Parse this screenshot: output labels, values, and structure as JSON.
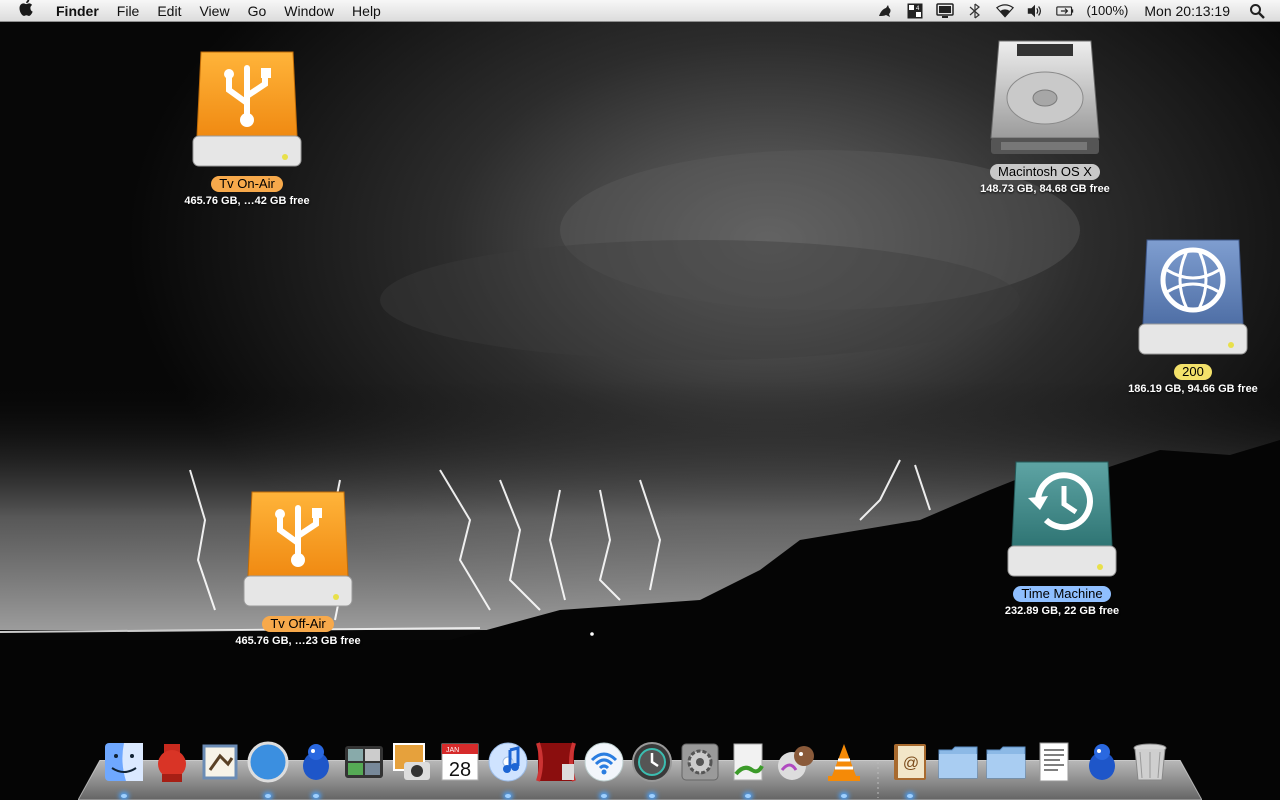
{
  "menubar": {
    "app_name": "Finder",
    "menus": [
      "File",
      "Edit",
      "View",
      "Go",
      "Window",
      "Help"
    ],
    "status_icons": [
      "growl-icon",
      "spaces-icon",
      "display-icon",
      "bluetooth-icon",
      "wifi-icon",
      "volume-icon"
    ],
    "battery_text": "(100%)",
    "clock": "Mon 20:13:19"
  },
  "desktop": {
    "icons": [
      {
        "name": "Tv On-Air",
        "info": "465.76 GB, …42 GB free",
        "type": "usb-drive",
        "label_color": "#f7a94b"
      },
      {
        "name": "Macintosh OS X",
        "info": "148.73 GB, 84.68 GB free",
        "type": "hard-drive",
        "label_color": "#c8c8c8"
      },
      {
        "name": "200",
        "info": "186.19 GB, 94.66 GB free",
        "type": "network-drive",
        "label_color": "#f3e16a"
      },
      {
        "name": "Tv Off-Air",
        "info": "465.76 GB, …23 GB free",
        "type": "usb-drive",
        "label_color": "#f7a94b"
      },
      {
        "name": "Time Machine",
        "info": "232.89 GB, 22 GB free",
        "type": "time-machine-drive",
        "label_color": "#8fbfff"
      }
    ]
  },
  "dock": {
    "apps": [
      "Finder",
      "Growl",
      "Mail",
      "Safari",
      "Adium",
      "Dashboard",
      "iPhoto",
      "iCal",
      "iTunes",
      "Front Row",
      "AirPort",
      "Time Machine",
      "System Preferences",
      "Script Editor",
      "Audio",
      "VLC"
    ],
    "ical_date": "28",
    "ical_month": "JAN",
    "stacks": [
      "Address Book",
      "Documents",
      "Downloads",
      "Preview",
      "Adium",
      "Trash"
    ],
    "running": [
      "Finder",
      "Safari",
      "Adium",
      "iTunes",
      "AirPort",
      "Time Machine",
      "Script Editor",
      "VLC",
      "Address Book"
    ]
  }
}
